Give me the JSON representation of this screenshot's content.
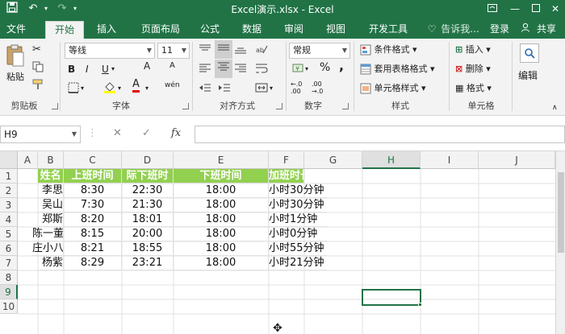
{
  "titlebar": {
    "title": "Excel演示.xlsx - Excel",
    "qa_save_icon": "save-icon",
    "qa_undo_icon": "undo-icon",
    "qa_redo_icon": "redo-icon",
    "qa_customize_icon": "customize-qat-icon",
    "ribbon_display_icon": "ribbon-display-icon",
    "minimize_icon": "minimize-icon",
    "maximize_icon": "maximize-icon",
    "close_icon": "close-icon"
  },
  "tabs": [
    "文件",
    "开始",
    "插入",
    "页面布局",
    "公式",
    "数据",
    "审阅",
    "视图",
    "开发工具"
  ],
  "active_tab": "开始",
  "tell_me": "告诉我...",
  "login": "登录",
  "share": "共享",
  "clipboard": {
    "paste": "粘贴",
    "group": "剪贴板"
  },
  "font": {
    "name": "等线",
    "size": "11",
    "grow": "A",
    "shrink": "A",
    "bold": "B",
    "italic": "I",
    "underline": "U",
    "font_color": "A",
    "phonetic": "wén",
    "group": "字体"
  },
  "alignment": {
    "group": "对齐方式"
  },
  "number": {
    "format": "常规",
    "percent": "%",
    "comma": ",",
    "group": "数字"
  },
  "styles": {
    "conditional": "条件格式",
    "table": "套用表格格式",
    "cell_styles": "单元格样式",
    "group": "样式"
  },
  "cells": {
    "insert": "插入",
    "delete": "删除",
    "format": "格式",
    "group": "单元格"
  },
  "editing": {
    "label": "编辑"
  },
  "formula_bar": {
    "name_box": "H9",
    "cancel": "✕",
    "enter": "✓",
    "fx": "fx",
    "value": ""
  },
  "columns": [
    "A",
    "B",
    "C",
    "D",
    "E",
    "F",
    "G",
    "H",
    "I",
    "J"
  ],
  "rows": [
    "1",
    "2",
    "3",
    "4",
    "5",
    "6",
    "7",
    "8",
    "9",
    "10"
  ],
  "selected_cell": "H9",
  "table": {
    "headers": [
      "姓名",
      "上班时间",
      "际下班时",
      "下班时间",
      "加班时长"
    ],
    "rows": [
      [
        "李思",
        "8:30",
        "22:30",
        "18:00",
        "小时30分钟"
      ],
      [
        "吴山",
        "7:30",
        "21:30",
        "18:00",
        "小时30分钟"
      ],
      [
        "郑斯",
        "8:20",
        "18:01",
        "18:00",
        "小时1分钟"
      ],
      [
        "陈一董",
        "8:15",
        "20:00",
        "18:00",
        "小时0分钟"
      ],
      [
        "庄小八",
        "8:21",
        "18:55",
        "18:00",
        "小时55分钟"
      ],
      [
        "杨紫",
        "8:29",
        "23:21",
        "18:00",
        "小时21分钟"
      ]
    ]
  },
  "colors": {
    "brand": "#217346",
    "header_fill": "#92d050"
  }
}
